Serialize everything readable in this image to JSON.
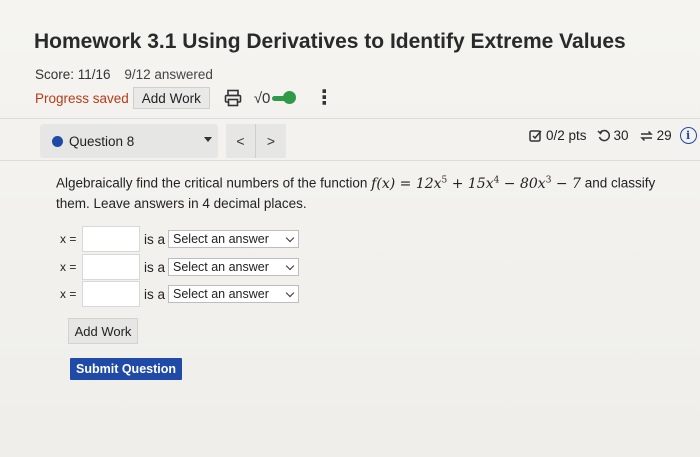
{
  "header": {
    "title": "Homework 3.1 Using Derivatives to Identify Extreme Values",
    "score": "Score: 11/16",
    "answered": "9/12 answered",
    "progress_saved": "Progress saved",
    "add_work_label": "Add Work",
    "sqrt_label": "√0",
    "kebab_label": "⋮"
  },
  "question_nav": {
    "label": "Question 8",
    "prev": "<",
    "next": ">"
  },
  "stats": {
    "points": "0/2 pts",
    "retries": "30",
    "attempts": "29",
    "info": "i"
  },
  "prompt": {
    "lead": "Algebraically find the critical numbers of the function ",
    "fx": "f(x) = ",
    "t1": "12x",
    "e1": "5",
    "t2": " + 15x",
    "e2": "4",
    "t3": " − 80x",
    "e3": "3",
    "t4": " − 7",
    "tail": " and classify them. Leave answers in 4 decimal places."
  },
  "answers": [
    {
      "x_label": "x =",
      "value": "",
      "is_a": "is a",
      "select": "Select an answer"
    },
    {
      "x_label": "x =",
      "value": "",
      "is_a": "is a",
      "select": "Select an answer"
    },
    {
      "x_label": "x =",
      "value": "",
      "is_a": "is a",
      "select": "Select an answer"
    }
  ],
  "buttons": {
    "add_work": "Add Work",
    "submit": "Submit Question"
  },
  "colors": {
    "accent": "#1f4aa8",
    "progress_saved": "#b73b18",
    "toggle": "#2f9b49"
  }
}
